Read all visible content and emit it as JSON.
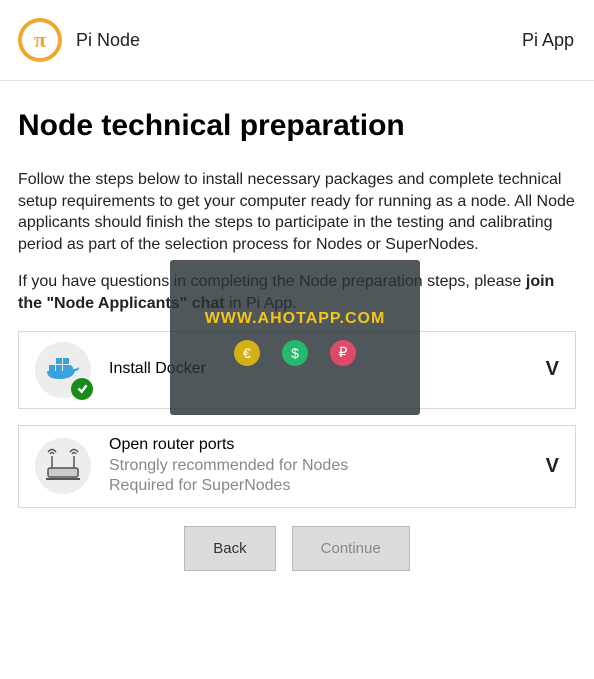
{
  "header": {
    "left_title": "Pi Node",
    "right_title": "Pi App"
  },
  "page": {
    "title": "Node technical preparation",
    "intro1": "Follow the steps below to install necessary packages and complete technical setup requirements to get your computer ready for running as a node. All Node applicants should finish the steps to participate in the testing and calibrating period as part of the selection process for Nodes or SuperNodes.",
    "intro2_pre": "If you have questions in completing the Node preparation steps, please ",
    "intro2_bold": "join the \"Node Applicants\" chat",
    "intro2_post": " in Pi App."
  },
  "cards": {
    "docker": {
      "title": "Install Docker",
      "completed": true
    },
    "router": {
      "title": "Open router ports",
      "sub1": "Strongly recommended for Nodes",
      "sub2": "Required for SuperNodes"
    }
  },
  "buttons": {
    "back": "Back",
    "continue": "Continue"
  },
  "overlay": {
    "text": "WWW.AHOTAPP.COM",
    "d1": "€",
    "d2": "$",
    "d3": "₽"
  }
}
